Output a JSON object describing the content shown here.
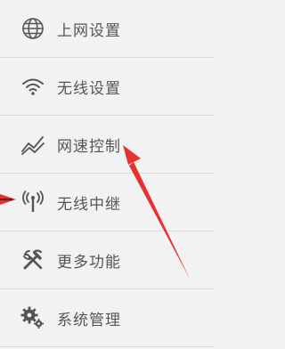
{
  "menu": {
    "items": [
      {
        "label": "上网设置",
        "icon": "globe-icon"
      },
      {
        "label": "无线设置",
        "icon": "wifi-icon"
      },
      {
        "label": "网速控制",
        "icon": "speed-chart-icon"
      },
      {
        "label": "无线中继",
        "icon": "antenna-signal-icon"
      },
      {
        "label": "更多功能",
        "icon": "tools-icon"
      },
      {
        "label": "系统管理",
        "icon": "gears-icon"
      }
    ]
  },
  "colors": {
    "background": "#f2f2f2",
    "icon": "#555555",
    "text": "#555555",
    "divider": "#dcdcdc",
    "annotation_arrow": "#e8312f"
  }
}
